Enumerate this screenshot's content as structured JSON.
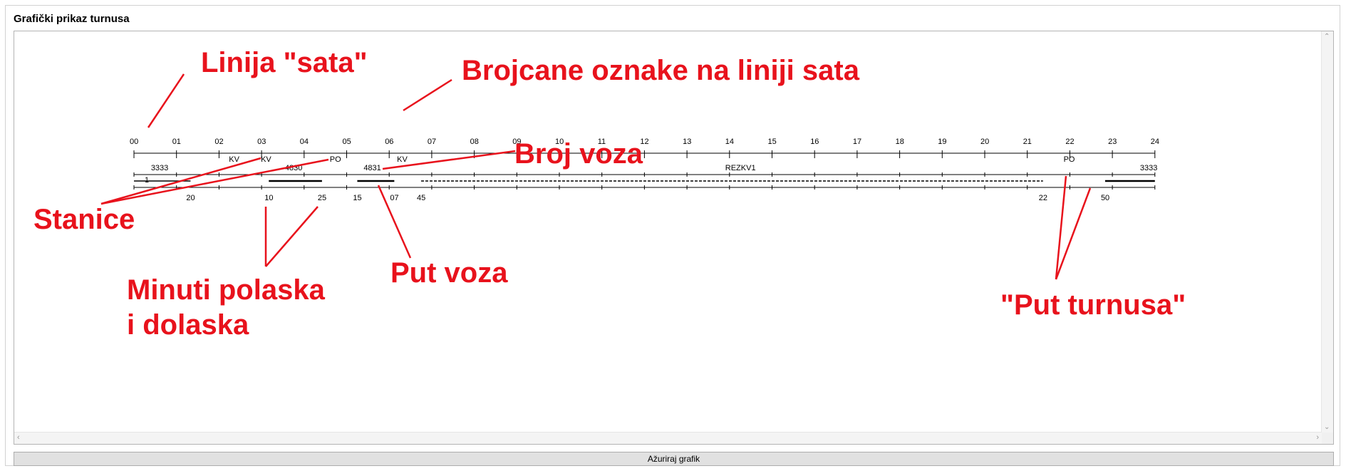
{
  "panel": {
    "title": "Grafički prikaz turnusa"
  },
  "button": {
    "update_label": "Ažuriraj grafik"
  },
  "hour_labels": [
    "00",
    "01",
    "02",
    "03",
    "04",
    "05",
    "06",
    "07",
    "08",
    "09",
    "10",
    "11",
    "12",
    "13",
    "14",
    "15",
    "16",
    "17",
    "18",
    "19",
    "20",
    "21",
    "22",
    "23",
    "24"
  ],
  "stations": [
    {
      "text": "KV",
      "hour": 2.35
    },
    {
      "text": "KV",
      "hour": 3.1
    },
    {
      "text": "PO",
      "hour": 4.72
    },
    {
      "text": "KV",
      "hour": 6.3
    },
    {
      "text": "PO",
      "hour": 21.97
    }
  ],
  "train_numbers": [
    {
      "text": "3333",
      "hour": 0.6
    },
    {
      "text": "4830",
      "hour": 3.75
    },
    {
      "text": "4831",
      "hour": 5.6
    },
    {
      "text": "REZKV1",
      "hour": 14.1
    },
    {
      "text": "3333",
      "hour": 23.85
    }
  ],
  "small_marker": {
    "text": "1"
  },
  "minute_labels": [
    {
      "text": "20",
      "hour": 1.33
    },
    {
      "text": "10",
      "hour": 3.17
    },
    {
      "text": "25",
      "hour": 4.42
    },
    {
      "text": "15",
      "hour": 5.25
    },
    {
      "text": "07",
      "hour": 6.12
    },
    {
      "text": "45",
      "hour": 6.75
    },
    {
      "text": "22",
      "hour": 21.37
    },
    {
      "text": "50",
      "hour": 22.83
    }
  ],
  "train_paths": [
    {
      "start": 0.0,
      "end": 1.33,
      "style": "solid-thin"
    },
    {
      "start": 3.17,
      "end": 4.42,
      "style": "solid"
    },
    {
      "start": 5.25,
      "end": 6.12,
      "style": "solid"
    },
    {
      "start": 6.75,
      "end": 21.37,
      "style": "dashed"
    },
    {
      "start": 22.83,
      "end": 24.0,
      "style": "solid"
    }
  ],
  "annotations": [
    {
      "id": "hour-line",
      "text": "Linija \"sata\""
    },
    {
      "id": "hour-numbers",
      "text": "Brojcane oznake na liniji sata"
    },
    {
      "id": "train-number",
      "text": "Broj voza"
    },
    {
      "id": "stations",
      "text": "Stanice"
    },
    {
      "id": "minutes-line1",
      "text": "Minuti polaska"
    },
    {
      "id": "minutes-line2",
      "text": "i dolaska"
    },
    {
      "id": "train-path",
      "text": "Put voza"
    },
    {
      "id": "rotation-path",
      "text": "\"Put turnusa\""
    }
  ],
  "colors": {
    "annotation": "#e8121c",
    "path": "#000000",
    "axis": "#000000"
  }
}
